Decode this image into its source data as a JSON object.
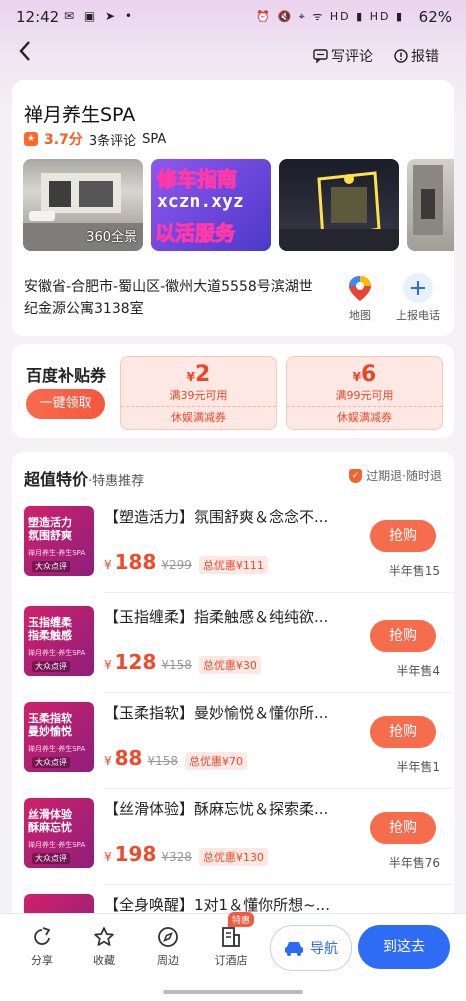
{
  "status_bar": {
    "time": "12:42",
    "left_icons": "✉ ▣ ➤ •",
    "right_icons": "⏰ 🔇 ⌖ ᯤ HD ▮ HD ▮",
    "battery": "62%"
  },
  "nav": {
    "write_review": "写评论",
    "report_error": "报错"
  },
  "shop": {
    "name": "禅月养生SPA",
    "score": "3.7分",
    "reviews": "3条评论",
    "category": "SPA",
    "photo_overlay_label": "360全景",
    "ad_text_1": "修车指南",
    "ad_text_2": "xczn.xyz",
    "ad_text_3": "以活服务",
    "address": "安徽省-合肥市-蜀山区-徽州大道5558号滨湖世纪金源公寓3138室",
    "map_label": "地图",
    "phone_label": "上报电话"
  },
  "coupons": {
    "title": "百度补贴券",
    "claim_label": "一键领取",
    "items": [
      {
        "amount": "2",
        "condition": "满39元可用",
        "type": "休娱满减券"
      },
      {
        "amount": "6",
        "condition": "满99元可用",
        "type": "休娱满减券"
      }
    ]
  },
  "deals": {
    "header_bold": "超值特价",
    "header_sub": "·特惠推荐",
    "refund_label": "过期退·随时退",
    "buy_label": "抢购",
    "currency": "¥",
    "items": [
      {
        "title": "【塑造活力】氛围舒爽＆念念不...",
        "price": "188",
        "original": "¥299",
        "save": "总优惠¥111",
        "sold": "半年售15",
        "img_text": "塑造活力\n氛围舒爽"
      },
      {
        "title": "【玉指缠柔】指柔触感＆纯纯欲...",
        "price": "128",
        "original": "¥158",
        "save": "总优惠¥30",
        "sold": "半年售4",
        "img_text": "玉指缠柔\n指柔触感"
      },
      {
        "title": "【玉柔指软】曼妙愉悦＆懂你所...",
        "price": "88",
        "original": "¥158",
        "save": "总优惠¥70",
        "sold": "半年售1",
        "img_text": "玉柔指软\n曼妙愉悦"
      },
      {
        "title": "【丝滑体验】酥麻忘忧＆探索柔...",
        "price": "198",
        "original": "¥328",
        "save": "总优惠¥130",
        "sold": "半年售76",
        "img_text": "丝滑体验\n酥麻忘忧"
      },
      {
        "title": "【全身唤醒】1对1＆懂你所想~...",
        "price": "",
        "original": "",
        "save": "",
        "sold": "",
        "img_text": ""
      }
    ],
    "img_sub": "禅月养生·养生SPA",
    "img_tag": "大众点评"
  },
  "bottom_bar": {
    "share": "分享",
    "favorite": "收藏",
    "nearby": "周边",
    "hotel": "订酒店",
    "hotel_badge": "特惠",
    "navigate": "导航",
    "go_here": "到这去"
  }
}
